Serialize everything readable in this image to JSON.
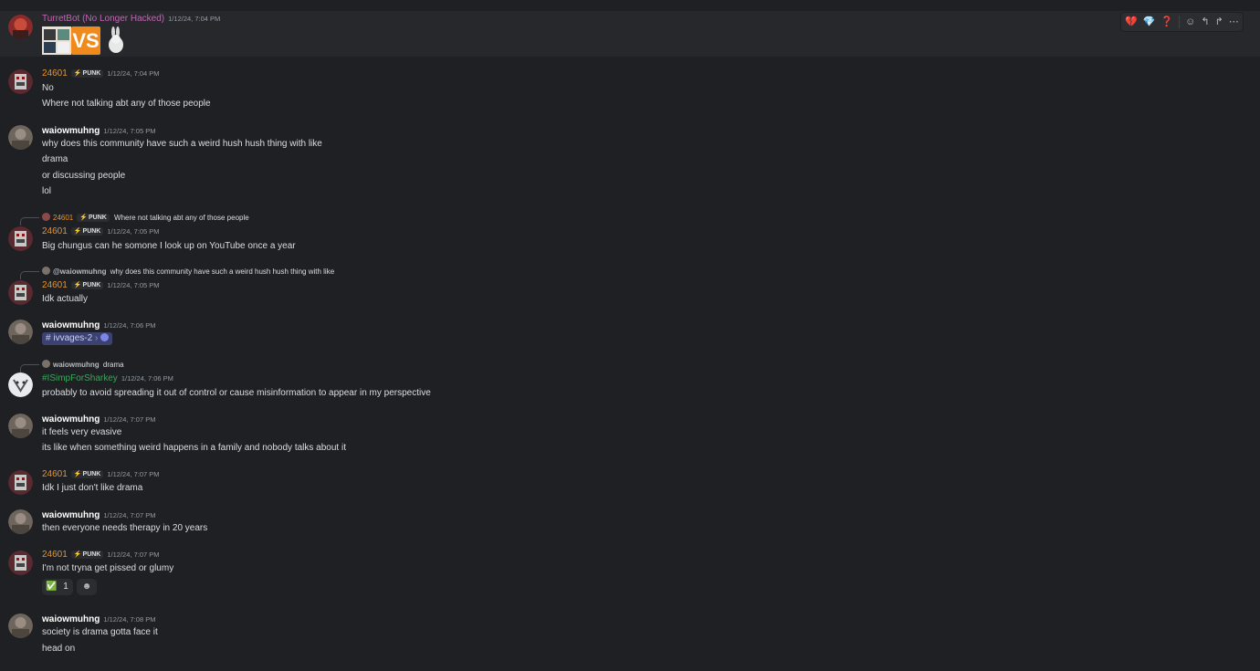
{
  "colors": {
    "background": "#1f2023",
    "hover_background": "#26282c",
    "turretbot": "#c464b6",
    "user_24601": "#e8932b",
    "user_waiowmuhng": "#ffffff",
    "user_isimp": "#3ba55d",
    "timestamp": "#949ba4"
  },
  "toolbar": {
    "icons": [
      "broken-heart-icon",
      "gem-icon",
      "question-icon",
      "add-reaction-icon",
      "reply-icon",
      "forward-icon",
      "more-icon"
    ],
    "glyphs": [
      "💔",
      "💎",
      "❓",
      "☺",
      "↰",
      "↱",
      "⋯"
    ]
  },
  "messages": [
    {
      "author": "TurretBot (No Longer Hacked)",
      "time": "1/12/24, 7:04 PM",
      "sticker_text": "VS"
    },
    {
      "author": "24601",
      "tag": "PUNK",
      "time": "1/12/24, 7:04 PM",
      "lines": [
        "No",
        "Where not talking abt any of those people"
      ]
    },
    {
      "author": "waiowmuhng",
      "time": "1/12/24, 7:05 PM",
      "lines": [
        "why does this community have such a weird hush hush thing with like",
        "drama",
        "or discussing people",
        "lol"
      ]
    },
    {
      "reply_author": "24601",
      "reply_tag": "PUNK",
      "reply_text": "Where not talking abt any of those people",
      "author": "24601",
      "tag": "PUNK",
      "time": "1/12/24, 7:05 PM",
      "lines": [
        "Big chungus can he somone I look up on YouTube once a year"
      ]
    },
    {
      "reply_author": "@waiowmuhng",
      "reply_text": "why does this community have such a weird hush hush thing with like",
      "author": "24601",
      "tag": "PUNK",
      "time": "1/12/24, 7:05 PM",
      "lines": [
        "Idk actually"
      ]
    },
    {
      "author": "waiowmuhng",
      "time": "1/12/24, 7:06 PM",
      "channel_pill": "ivvages-2",
      "channel_hash": "#"
    },
    {
      "reply_author": "waiowmuhng",
      "reply_text": "drama",
      "author": "#ISimpForSharkey",
      "time": "1/12/24, 7:06 PM",
      "lines": [
        "probably to avoid spreading it out of control or cause misinformation to appear in my perspective"
      ]
    },
    {
      "author": "waiowmuhng",
      "time": "1/12/24, 7:07 PM",
      "lines": [
        "it feels very evasive",
        "its like when something weird happens in a family and nobody talks about it"
      ]
    },
    {
      "author": "24601",
      "tag": "PUNK",
      "time": "1/12/24, 7:07 PM",
      "lines": [
        "Idk I just don't like drama"
      ]
    },
    {
      "author": "waiowmuhng",
      "time": "1/12/24, 7:07 PM",
      "lines": [
        "then everyone needs therapy in 20 years"
      ]
    },
    {
      "author": "24601",
      "tag": "PUNK",
      "time": "1/12/24, 7:07 PM",
      "lines": [
        "I'm not tryna get pissed or glumy"
      ],
      "reaction_emoji": "✅",
      "reaction_count": "1",
      "add_reaction_glyph": "☻"
    },
    {
      "author": "waiowmuhng",
      "time": "1/12/24, 7:08 PM",
      "lines": [
        "society is drama gotta face it",
        "head on"
      ]
    }
  ]
}
